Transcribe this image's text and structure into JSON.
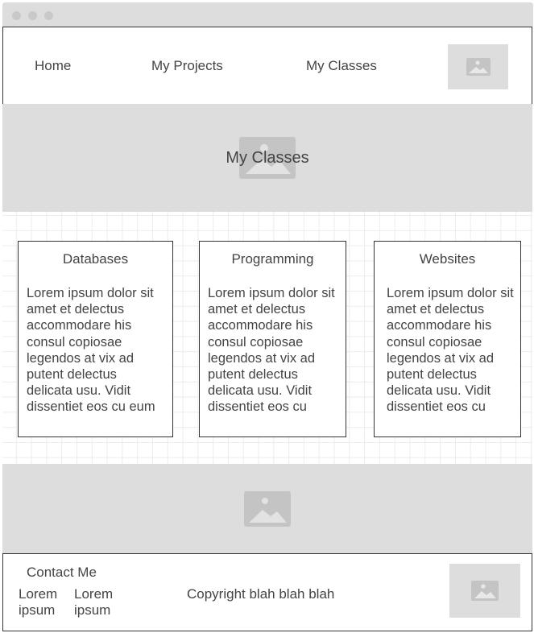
{
  "nav": {
    "links": [
      "Home",
      "My Projects",
      "My Classes"
    ]
  },
  "hero": {
    "title": "My Classes"
  },
  "cards": [
    {
      "title": "Databases",
      "body": "Lorem ipsum dolor sit amet et delectus accommodare his consul copiosae legendos at vix ad putent delectus delicata usu. Vidit dissentiet eos cu eum"
    },
    {
      "title": "Programming",
      "body": "Lorem ipsum dolor sit amet et delectus accommodare his consul copiosae legendos at vix ad putent delectus delicata usu. Vidit dissentiet eos cu"
    },
    {
      "title": "Websites",
      "body": "Lorem ipsum dolor sit amet et delectus accommodare his consul copiosae legendos at vix ad putent delectus delicata usu. Vidit dissentiet eos cu"
    }
  ],
  "footer": {
    "contact_label": "Contact Me",
    "links": [
      "Lorem ipsum",
      "Lorem ipsum"
    ],
    "copyright": "Copyright blah blah blah"
  },
  "colors": {
    "placeholder": "#dddddd",
    "placeholder_icon": "#c4c4c4",
    "text": "#444444",
    "border": "#333333"
  }
}
